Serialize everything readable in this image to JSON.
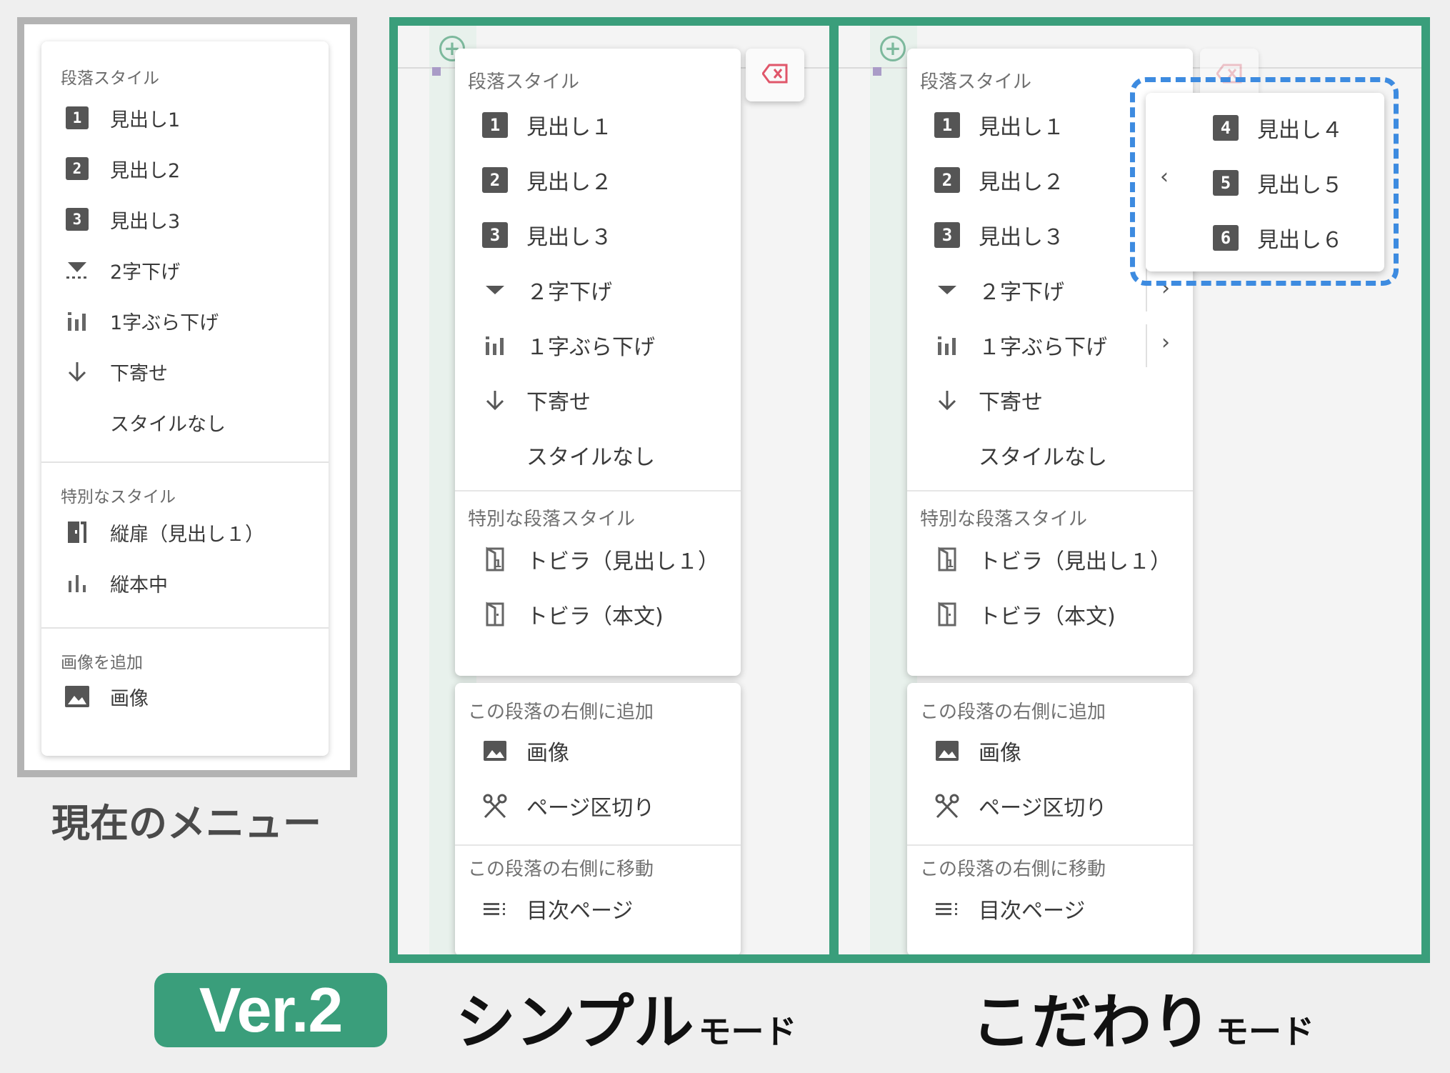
{
  "current_menu": {
    "sections": [
      {
        "heading": "段落スタイル",
        "items": [
          {
            "label": "見出し1",
            "icon": "heading-1-icon",
            "badge": "1"
          },
          {
            "label": "見出し2",
            "icon": "heading-2-icon",
            "badge": "2"
          },
          {
            "label": "見出し3",
            "icon": "heading-3-icon",
            "badge": "3"
          },
          {
            "label": "2字下げ",
            "icon": "indent-2-icon"
          },
          {
            "label": "1字ぶら下げ",
            "icon": "hanging-indent-icon"
          },
          {
            "label": "下寄せ",
            "icon": "align-bottom-icon"
          },
          {
            "label": "スタイルなし",
            "icon": ""
          }
        ]
      },
      {
        "heading": "特別なスタイル",
        "items": [
          {
            "label": "縦扉（見出し１）",
            "icon": "door-icon"
          },
          {
            "label": "縦本中",
            "icon": "bar-icon"
          }
        ]
      },
      {
        "heading": "画像を追加",
        "items": [
          {
            "label": "画像",
            "icon": "image-icon"
          }
        ]
      }
    ],
    "caption": "現在のメニュー"
  },
  "mode_menu": {
    "style_heading": "段落スタイル",
    "style_items": [
      {
        "label": "見出し１",
        "badge": "1"
      },
      {
        "label": "見出し２",
        "badge": "2"
      },
      {
        "label": "見出し３",
        "badge": "3"
      },
      {
        "label": "２字下げ"
      },
      {
        "label": "１字ぶら下げ"
      },
      {
        "label": "下寄せ"
      },
      {
        "label": "スタイルなし"
      }
    ],
    "special_heading": "特別な段落スタイル",
    "special_items": [
      {
        "label": "トビラ（見出し１）"
      },
      {
        "label": "トビラ（本文)"
      }
    ],
    "add_heading": "この段落の右側に追加",
    "add_items": [
      {
        "label": "画像"
      },
      {
        "label": "ページ区切り"
      }
    ],
    "move_heading": "この段落の右側に移動",
    "move_items": [
      {
        "label": "目次ページ"
      }
    ]
  },
  "submenu": {
    "items": [
      {
        "label": "見出し４",
        "badge": "4"
      },
      {
        "label": "見出し５",
        "badge": "5"
      },
      {
        "label": "見出し６",
        "badge": "6"
      }
    ]
  },
  "captions": {
    "version": "Ver.2",
    "simple_big": "シンプル",
    "simple_small": "モード",
    "detail_big": "こだわり",
    "detail_small": "モード"
  },
  "colors": {
    "accent": "#3a9e7b",
    "dash": "#3d8be0",
    "delete": "#e0566a"
  }
}
